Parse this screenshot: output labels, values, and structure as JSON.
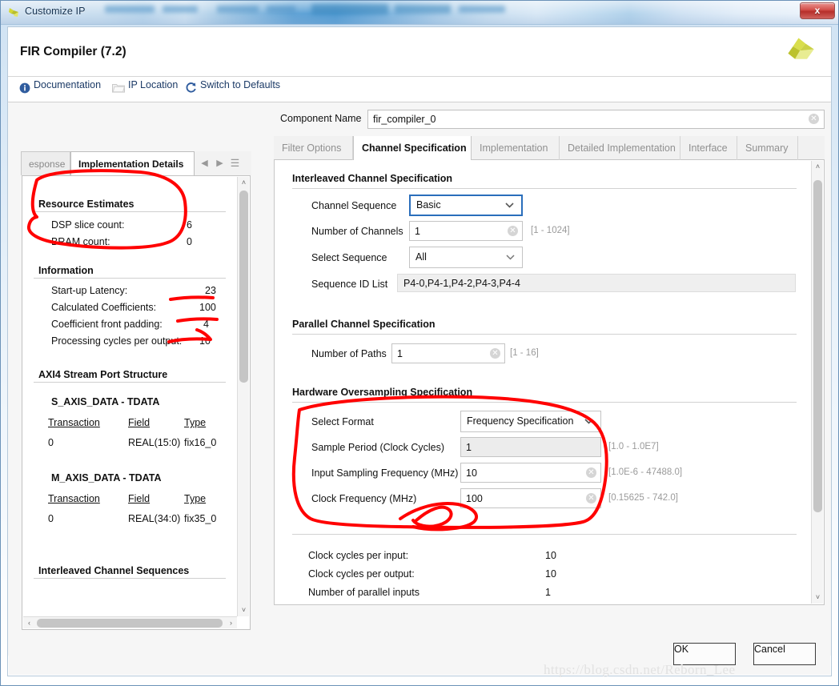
{
  "window": {
    "title": "Customize IP",
    "close_label": "x",
    "app_icon": "xilinx-logo-icon"
  },
  "dialog": {
    "title": "FIR Compiler (7.2)",
    "logo": "xilinx-pinwheel-logo"
  },
  "toolbar": {
    "items": [
      {
        "label": "Documentation",
        "icon": "info-icon"
      },
      {
        "label": "IP Location",
        "icon": "folder-icon"
      },
      {
        "label": "Switch to Defaults",
        "icon": "refresh-icon"
      }
    ]
  },
  "left_panel": {
    "tabs": [
      {
        "label": "esponse",
        "active": false
      },
      {
        "label": "Implementation Details",
        "active": true
      }
    ],
    "nav": {
      "prev": "◀",
      "next": "▶",
      "menu": "☰"
    },
    "sections": [
      {
        "header": "Resource Estimates",
        "rows": [
          {
            "label": "DSP slice count:",
            "value": "6"
          },
          {
            "label": "BRAM count:",
            "value": "0"
          }
        ]
      },
      {
        "header": "Information",
        "rows": [
          {
            "label": "Start-up Latency:",
            "value": "23"
          },
          {
            "label": "Calculated Coefficients:",
            "value": "100"
          },
          {
            "label": "Coefficient front padding:",
            "value": "4"
          },
          {
            "label": "Processing cycles per output:",
            "value": "10"
          }
        ]
      }
    ],
    "axi_header": "AXI4 Stream Port Structure",
    "axi_groups": [
      {
        "name": "S_AXIS_DATA - TDATA",
        "columns": [
          "Transaction",
          "Field",
          "Type"
        ],
        "rows": [
          [
            "0",
            "REAL(15:0)",
            "fix16_0"
          ]
        ]
      },
      {
        "name": "M_AXIS_DATA - TDATA",
        "columns": [
          "Transaction",
          "Field",
          "Type"
        ],
        "rows": [
          [
            "0",
            "REAL(34:0)",
            "fix35_0"
          ]
        ]
      }
    ],
    "interleaved_header": "Interleaved Channel Sequences",
    "scroll": {
      "up": "˄",
      "down": "˅",
      "left": "‹",
      "right": "›"
    }
  },
  "right_panel": {
    "component_name_label": "Component Name",
    "component_name_value": "fir_compiler_0",
    "clear_icon": "clear-circle-icon",
    "tabs": [
      {
        "label": "Filter Options",
        "active": false
      },
      {
        "label": "Channel Specification",
        "active": true
      },
      {
        "label": "Implementation",
        "active": false
      },
      {
        "label": "Detailed Implementation",
        "active": false
      },
      {
        "label": "Interface",
        "active": false
      },
      {
        "label": "Summary",
        "active": false
      }
    ],
    "interleaved": {
      "header": "Interleaved Channel Specification",
      "channel_sequence_label": "Channel Sequence",
      "channel_sequence_value": "Basic",
      "number_of_channels_label": "Number of Channels",
      "number_of_channels_value": "1",
      "number_of_channels_range": "[1 - 1024]",
      "select_sequence_label": "Select Sequence",
      "select_sequence_value": "All",
      "sequence_id_list_label": "Sequence ID List",
      "sequence_id_list_value": "P4-0,P4-1,P4-2,P4-3,P4-4"
    },
    "parallel": {
      "header": "Parallel Channel Specification",
      "number_of_paths_label": "Number of Paths",
      "number_of_paths_value": "1",
      "number_of_paths_range": "[1 - 16]"
    },
    "oversampling": {
      "header": "Hardware Oversampling Specification",
      "select_format_label": "Select Format",
      "select_format_value": "Frequency Specification",
      "sample_period_label": "Sample Period (Clock Cycles)",
      "sample_period_value": "1",
      "sample_period_range": "[1.0 - 1.0E7]",
      "input_sampling_label": "Input Sampling Frequency (MHz)",
      "input_sampling_value": "10",
      "input_sampling_range": "[1.0E-6 - 47488.0]",
      "clock_frequency_label": "Clock Frequency (MHz)",
      "clock_frequency_value": "100",
      "clock_frequency_range": "[0.15625 - 742.0]"
    },
    "summary_rows": [
      {
        "label": "Clock cycles per input:",
        "value": "10"
      },
      {
        "label": "Clock cycles per output:",
        "value": "10"
      },
      {
        "label": "Number of parallel inputs",
        "value": "1"
      }
    ],
    "scroll": {
      "up": "˄",
      "down": "˅"
    }
  },
  "footer": {
    "ok_label": "OK",
    "cancel_label": "Cancel",
    "watermark": "https://blog.csdn.net/Reborn_Lee"
  },
  "colors": {
    "accent_blue": "#2a6ebb",
    "annotation_red": "#ff0000",
    "title_blue": "#4d99d2",
    "logo_yellow": "#c9cf3a"
  }
}
